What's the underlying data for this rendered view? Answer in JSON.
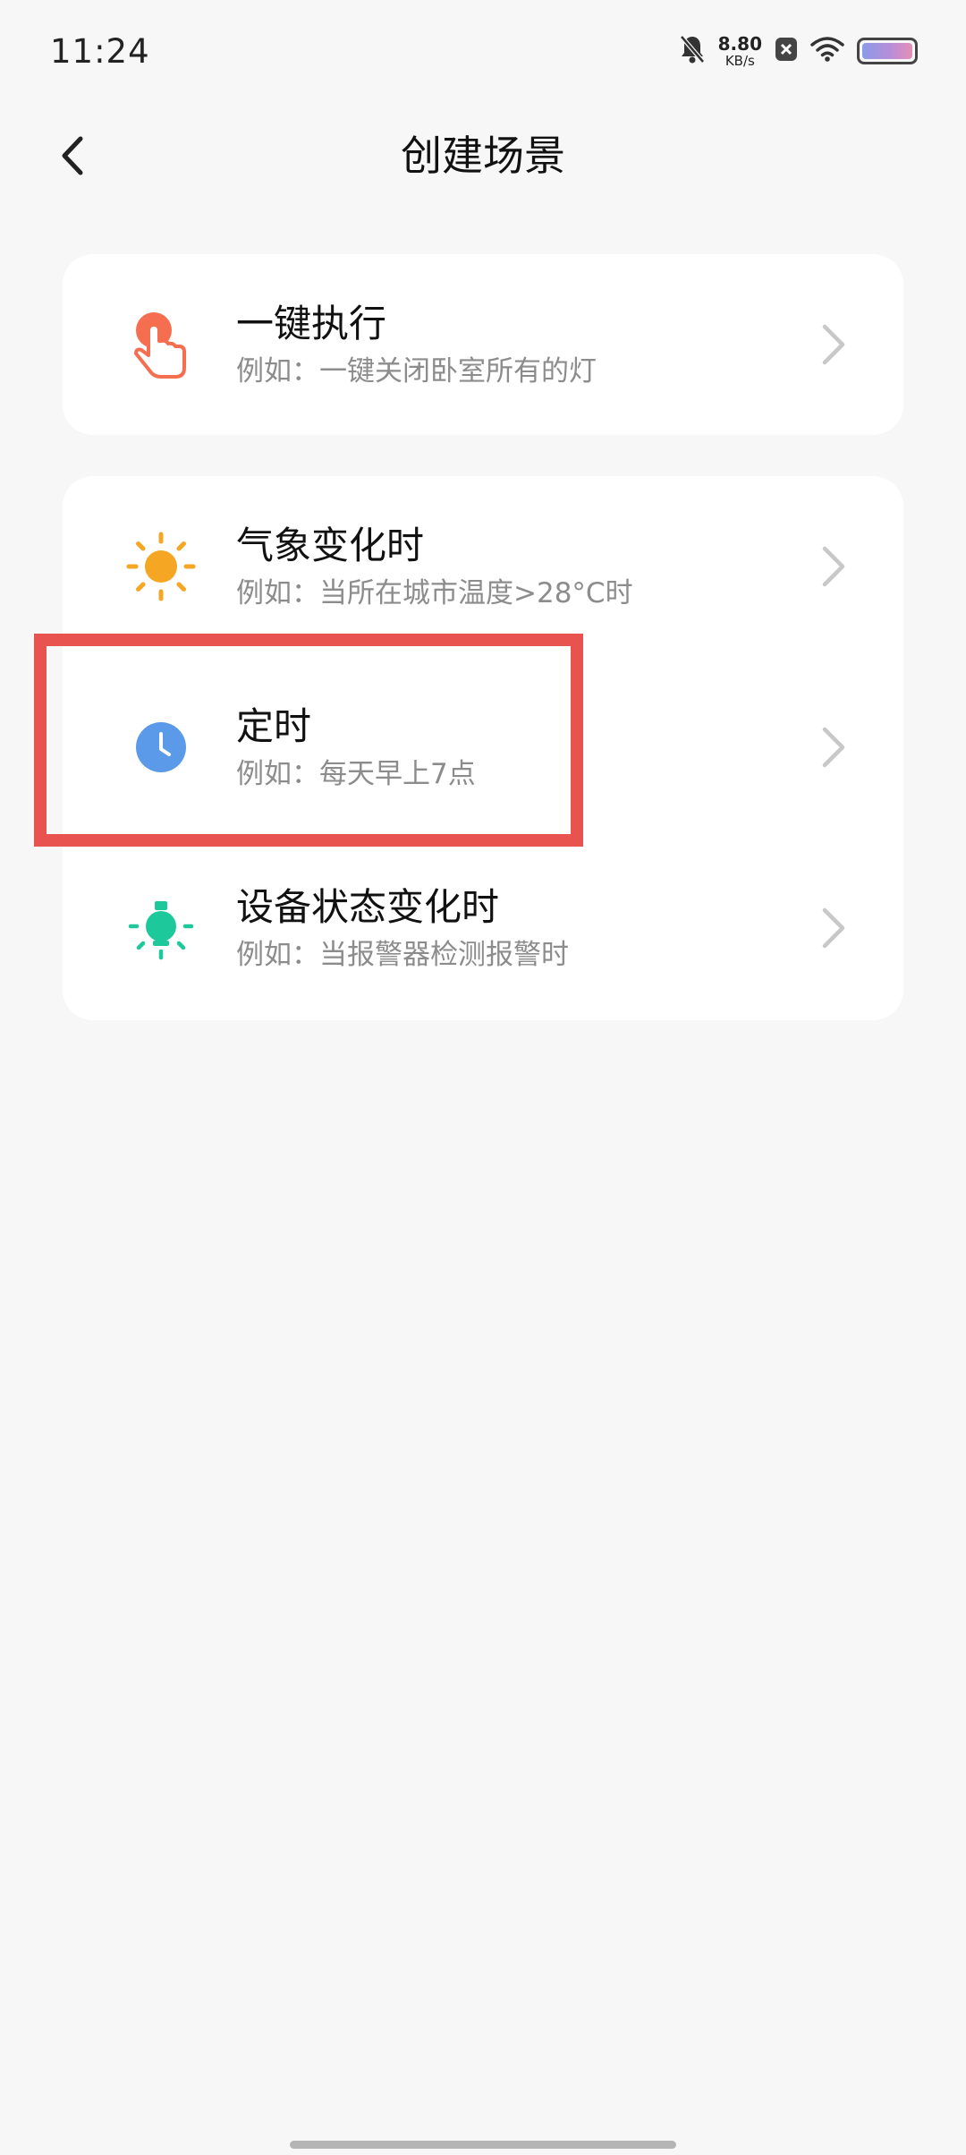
{
  "status_bar": {
    "time": "11:24",
    "speed_value": "8.80",
    "speed_unit": "KB/s"
  },
  "header": {
    "title": "创建场景"
  },
  "groups": [
    {
      "items": [
        {
          "title": "一键执行",
          "desc": "例如：一键关闭卧室所有的灯",
          "icon": "tap-hand-icon",
          "color": "#f56e4f"
        }
      ]
    },
    {
      "items": [
        {
          "title": "气象变化时",
          "desc": "例如：当所在城市温度>28°C时",
          "icon": "sun-icon",
          "color": "#f5a623"
        },
        {
          "title": "定时",
          "desc": "例如：每天早上7点",
          "icon": "clock-icon",
          "color": "#5b9ae8"
        },
        {
          "title": "设备状态变化时",
          "desc": "例如：当报警器检测报警时",
          "icon": "light-bulb-icon",
          "color": "#1dc99a"
        }
      ]
    }
  ],
  "highlight_color": "#e8524f"
}
